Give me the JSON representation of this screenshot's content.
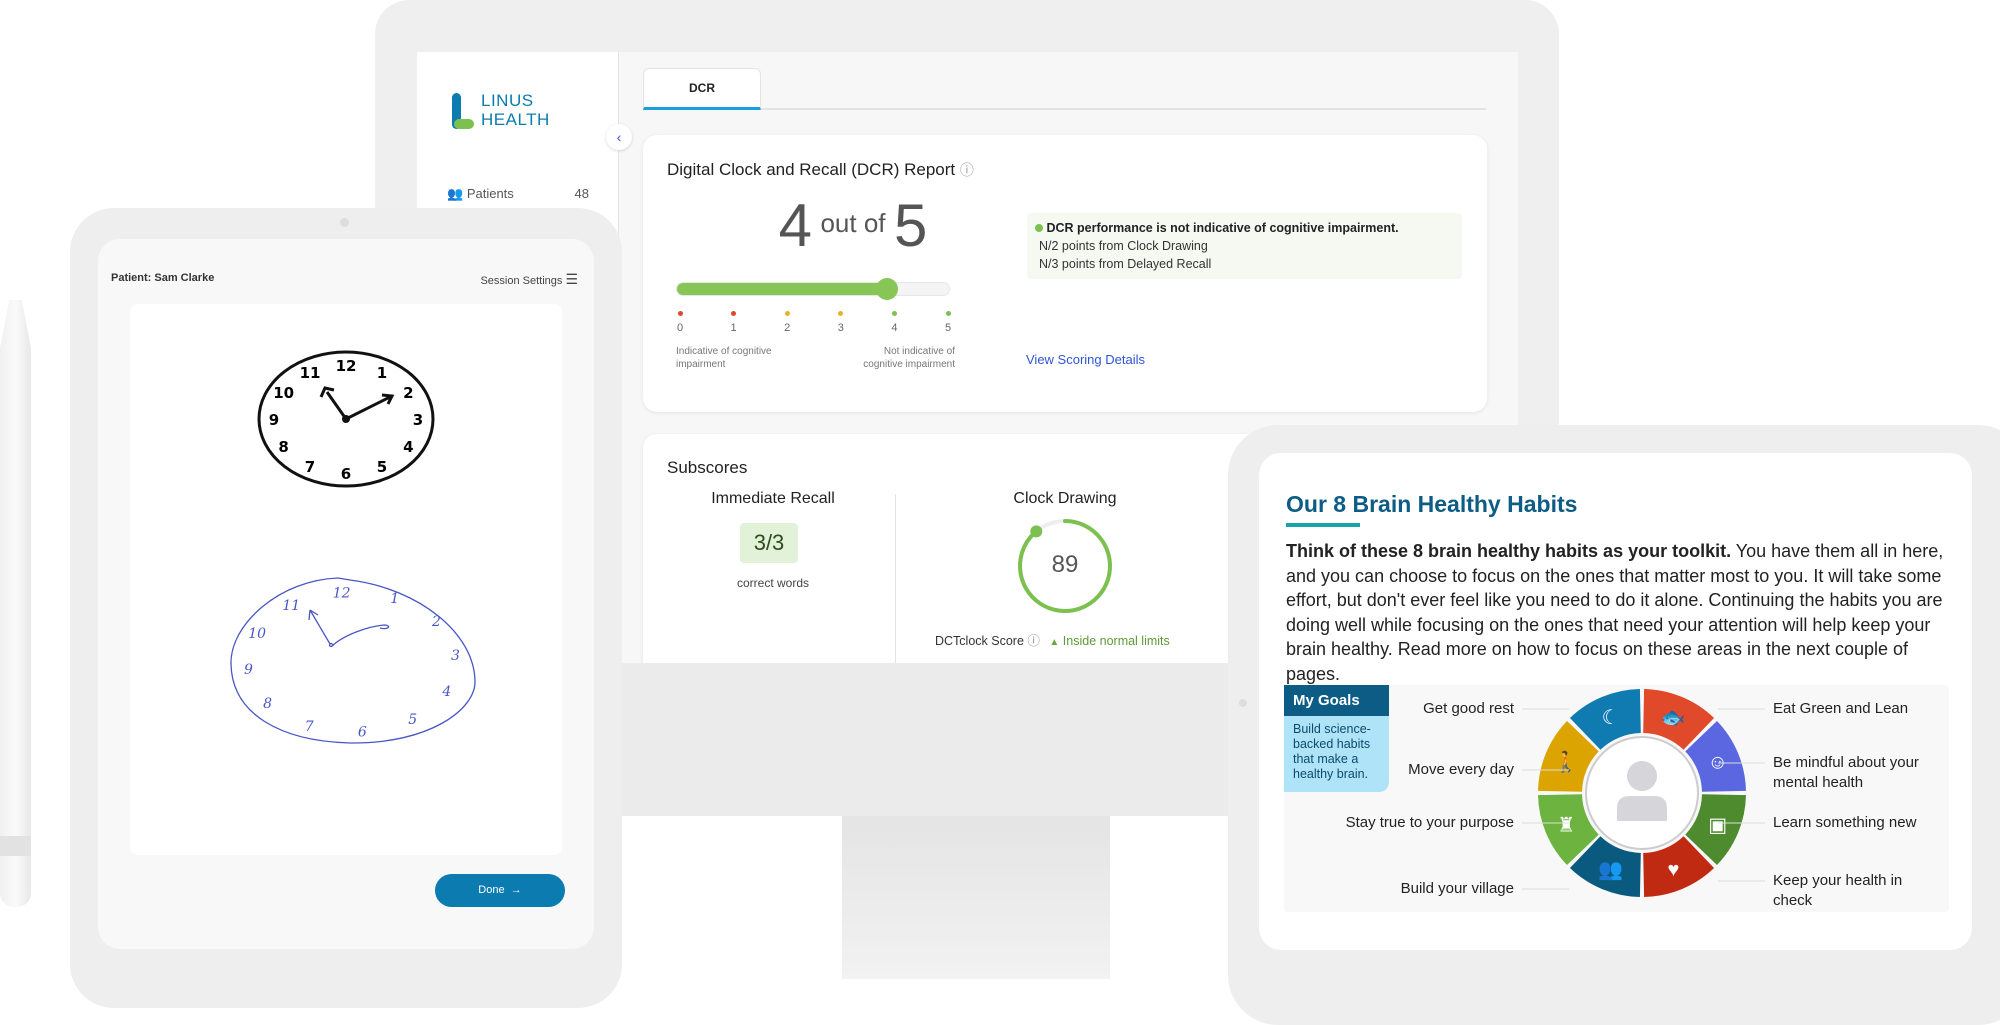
{
  "sidebar": {
    "logo_line1": "LINUS",
    "logo_line2": "HEALTH",
    "items": [
      {
        "label": "Patients",
        "count": "48"
      }
    ]
  },
  "tabs": [
    {
      "label": "DCR",
      "active": true
    }
  ],
  "report": {
    "title": "Digital Clock and Recall (DCR) Report",
    "score": "4",
    "out_of": "out of",
    "max": "5",
    "score_value": 4,
    "scale": [
      "0",
      "1",
      "2",
      "3",
      "4",
      "5"
    ],
    "scale_colors": [
      "#e0482c",
      "#e0482c",
      "#e0b52c",
      "#e0b52c",
      "#7cc04f",
      "#7cc04f"
    ],
    "left_caption": "Indicative of cognitive impairment",
    "right_caption": "Not indicative of cognitive impairment",
    "status": "DCR performance is not indicative of cognitive impairment.",
    "detail1": "N/2 points from Clock Drawing",
    "detail2": "N/3 points from Delayed Recall",
    "link": "View Scoring Details"
  },
  "subscores": {
    "title": "Subscores",
    "recall_title": "Immediate Recall",
    "recall_value": "3/3",
    "recall_caption": "correct words",
    "clock_title": "Clock Drawing",
    "clock_value": "89",
    "clock_fraction": 0.89,
    "clock_label": "DCTclock Score",
    "clock_status": "Inside normal limits"
  },
  "session": {
    "patient": "Patient: Sam Clarke",
    "settings": "Session Settings",
    "done": "Done",
    "done_arrow": "→",
    "clock_numbers": [
      "12",
      "1",
      "2",
      "3",
      "4",
      "5",
      "6",
      "7",
      "8",
      "9",
      "10",
      "11"
    ]
  },
  "habits": {
    "title": "Our 8 Brain Healthy Habits",
    "intro_bold": "Think of these 8 brain healthy habits as your toolkit.",
    "intro": " You have them all in here, and you can choose to focus on the ones that matter most to you. It will take some effort, but don't ever feel like you need to do it alone. Continuing the habits you are doing well while focusing on the ones that need your attention will help keep your brain healthy. Read more on how to focus on these areas in the next couple of pages.",
    "goals_title": "My Goals",
    "goals_text": "Build science-backed habits that make a healthy brain.",
    "items": [
      {
        "label": "Get good rest",
        "color": "#0f7bb0",
        "icon": "moon-sleep-icon",
        "glyph": "☾"
      },
      {
        "label": "Eat Green and Lean",
        "color": "#e04a2b",
        "icon": "fish-icon",
        "glyph": "🐟"
      },
      {
        "label": "Be mindful about your mental health",
        "color": "#5a67e0",
        "icon": "faces-icon",
        "glyph": "☺"
      },
      {
        "label": "Learn something new",
        "color": "#4e8a2e",
        "icon": "easel-icon",
        "glyph": "▣"
      },
      {
        "label": "Keep your health in check",
        "color": "#c02a12",
        "icon": "heart-icon",
        "glyph": "♥"
      },
      {
        "label": "Build your village",
        "color": "#0a5a7f",
        "icon": "people-icon",
        "glyph": "👥"
      },
      {
        "label": "Stay true to your purpose",
        "color": "#6db33f",
        "icon": "chess-king-icon",
        "glyph": "♜"
      },
      {
        "label": "Move every day",
        "color": "#dba400",
        "icon": "person-walking-icon",
        "glyph": "🚶"
      }
    ]
  },
  "colors": {
    "brand_blue": "#0c7bb0",
    "green": "#7cc04f",
    "link": "#2f55d4",
    "title_blue": "#0d5c86",
    "teal": "#1aa3a8"
  }
}
